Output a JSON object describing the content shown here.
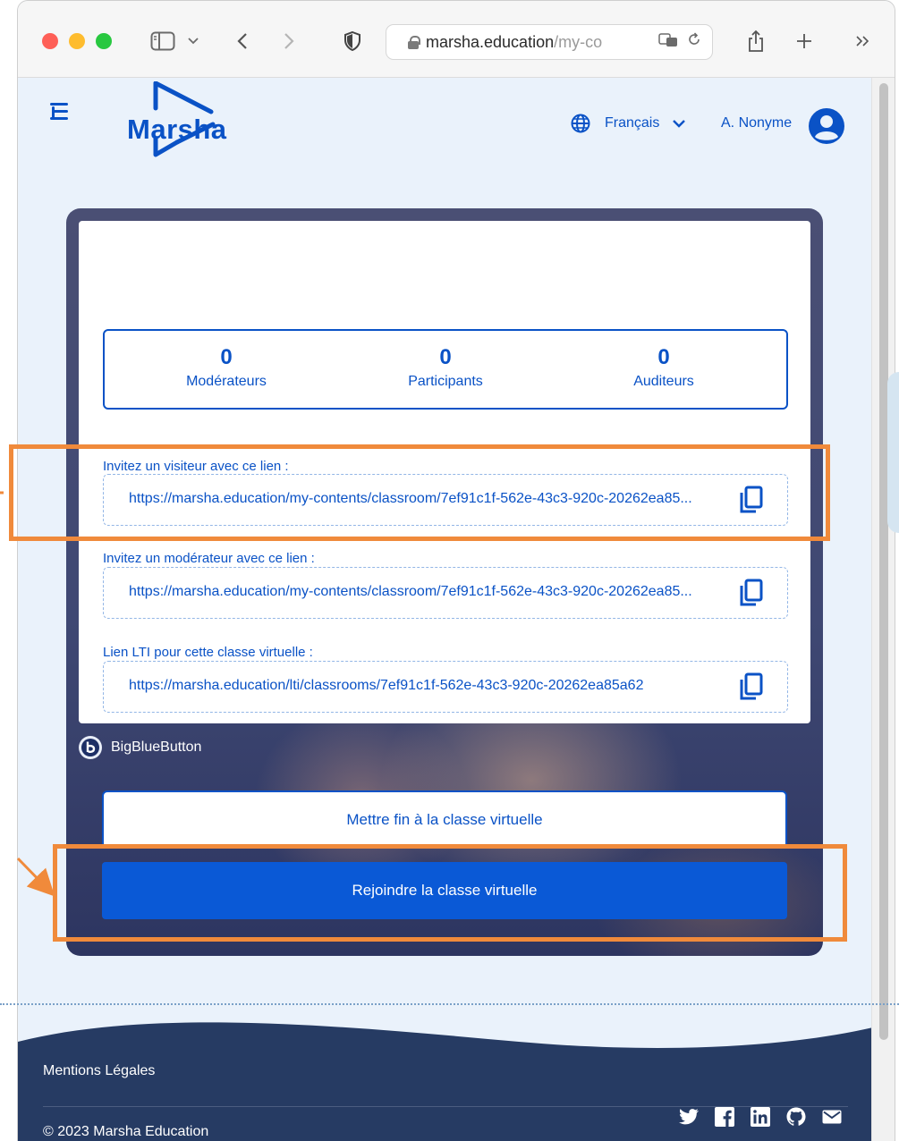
{
  "browser": {
    "address_domain": "marsha.education",
    "address_path_visible": "/my-co"
  },
  "header": {
    "logo_text": "Marsha",
    "language": "Français",
    "user_name": "A. Nonyme"
  },
  "stats": [
    {
      "value": "0",
      "label": "Modérateurs"
    },
    {
      "value": "0",
      "label": "Participants"
    },
    {
      "value": "0",
      "label": "Auditeurs"
    }
  ],
  "links": {
    "visitor": {
      "label": "Invitez un visiteur avec ce lien :",
      "url": "https://marsha.education/my-contents/classroom/7ef91c1f-562e-43c3-920c-20262ea85..."
    },
    "moderator": {
      "label": "Invitez un modérateur avec ce lien :",
      "url": "https://marsha.education/my-contents/classroom/7ef91c1f-562e-43c3-920c-20262ea85..."
    },
    "lti": {
      "label": "Lien LTI pour cette classe virtuelle :",
      "url": "https://marsha.education/lti/classrooms/7ef91c1f-562e-43c3-920c-20262ea85a62"
    }
  },
  "provider": {
    "name": "BigBlueButton",
    "logo_letter": "b"
  },
  "actions": {
    "end_label": "Mettre fin à la classe virtuelle",
    "join_label": "Rejoindre la classe virtuelle"
  },
  "footer": {
    "legal_link": "Mentions Légales",
    "copyright": "© 2023 Marsha Education",
    "socials": [
      "twitter-icon",
      "facebook-icon",
      "linkedin-icon",
      "github-icon",
      "mail-icon"
    ]
  },
  "colors": {
    "primary": "#0a52c6",
    "button": "#0a59d6",
    "footer": "#263b63",
    "annotation": "#f08a3b",
    "page_bg": "#eaf2fb"
  }
}
